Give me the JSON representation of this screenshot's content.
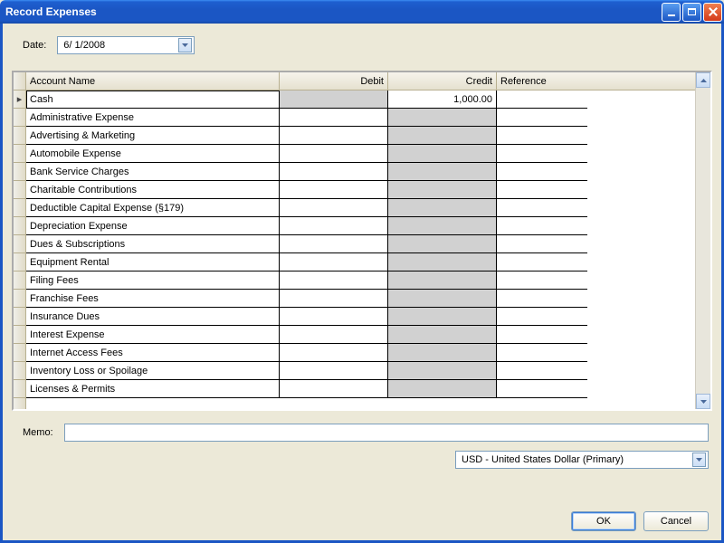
{
  "window": {
    "title": "Record Expenses"
  },
  "date": {
    "label": "Date:",
    "value": "6/  1/2008"
  },
  "grid": {
    "columns": {
      "name": "Account Name",
      "debit": "Debit",
      "credit": "Credit",
      "ref": "Reference"
    },
    "rows": [
      {
        "name": "Cash",
        "debit": "",
        "credit": "1,000.00",
        "ref": "",
        "debit_disabled": true,
        "selected": true
      },
      {
        "name": "Administrative Expense",
        "debit": "",
        "credit": "",
        "ref": "",
        "credit_disabled": true
      },
      {
        "name": "Advertising & Marketing",
        "debit": "",
        "credit": "",
        "ref": "",
        "credit_disabled": true
      },
      {
        "name": "Automobile Expense",
        "debit": "",
        "credit": "",
        "ref": "",
        "credit_disabled": true
      },
      {
        "name": "Bank Service Charges",
        "debit": "",
        "credit": "",
        "ref": "",
        "credit_disabled": true
      },
      {
        "name": "Charitable Contributions",
        "debit": "",
        "credit": "",
        "ref": "",
        "credit_disabled": true
      },
      {
        "name": "Deductible Capital Expense (§179)",
        "debit": "",
        "credit": "",
        "ref": "",
        "credit_disabled": true
      },
      {
        "name": "Depreciation Expense",
        "debit": "",
        "credit": "",
        "ref": "",
        "credit_disabled": true
      },
      {
        "name": "Dues & Subscriptions",
        "debit": "",
        "credit": "",
        "ref": "",
        "credit_disabled": true
      },
      {
        "name": "Equipment Rental",
        "debit": "",
        "credit": "",
        "ref": "",
        "credit_disabled": true
      },
      {
        "name": "Filing Fees",
        "debit": "",
        "credit": "",
        "ref": "",
        "credit_disabled": true
      },
      {
        "name": "Franchise Fees",
        "debit": "",
        "credit": "",
        "ref": "",
        "credit_disabled": true
      },
      {
        "name": "Insurance Dues",
        "debit": "",
        "credit": "",
        "ref": "",
        "credit_disabled": true
      },
      {
        "name": "Interest Expense",
        "debit": "",
        "credit": "",
        "ref": "",
        "credit_disabled": true
      },
      {
        "name": "Internet Access Fees",
        "debit": "",
        "credit": "",
        "ref": "",
        "credit_disabled": true
      },
      {
        "name": "Inventory Loss or Spoilage",
        "debit": "",
        "credit": "",
        "ref": "",
        "credit_disabled": true
      },
      {
        "name": "Licenses & Permits",
        "debit": "",
        "credit": "",
        "ref": "",
        "credit_disabled": true
      }
    ]
  },
  "memo": {
    "label": "Memo:",
    "value": ""
  },
  "currency": {
    "value": "USD - United States Dollar (Primary)"
  },
  "buttons": {
    "ok": "OK",
    "cancel": "Cancel"
  }
}
